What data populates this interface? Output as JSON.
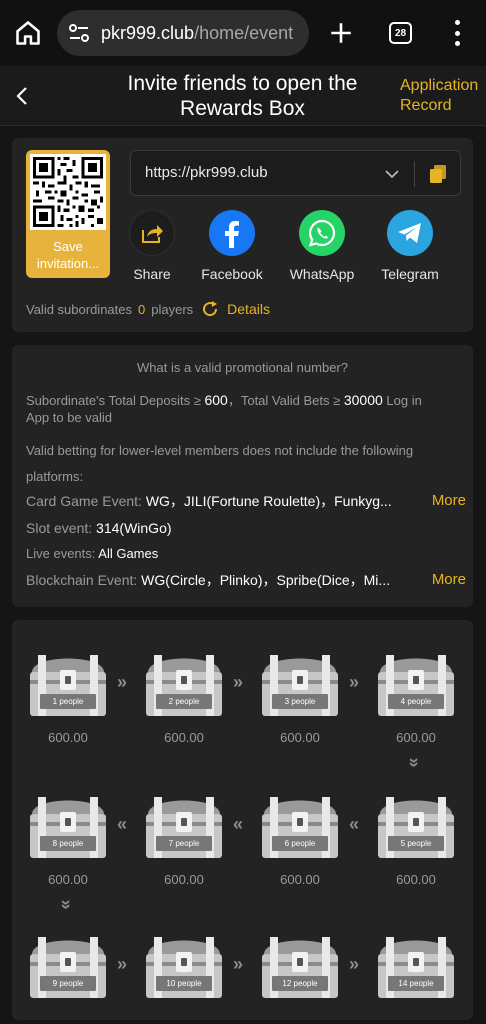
{
  "browser": {
    "url_host": "pkr999.club",
    "url_path": "/home/event",
    "tab_count": "28"
  },
  "header": {
    "title": "Invite friends to open the Rewards Box",
    "record_label": "Application Record"
  },
  "invite": {
    "save_label": "Save invitation...",
    "link": "https://pkr999.club",
    "share_label": "Share",
    "facebook_label": "Facebook",
    "whatsapp_label": "WhatsApp",
    "telegram_label": "Telegram",
    "valid_label": "Valid subordinates",
    "valid_count": "0",
    "players_label": "players",
    "details_label": "Details"
  },
  "rules": {
    "title": "What is a valid promotional number?",
    "line1_a": "Subordinate's Total Deposits ≥ ",
    "line1_b": "600",
    "line1_c": "，Total Valid Bets ≥ ",
    "line1_d": "30000",
    "line1_e": " Log in",
    "line2": "App to be valid",
    "line3": "Valid betting for lower-level members does not include the following",
    "line4": "platforms:",
    "card_label": "Card Game Event: ",
    "card_value": "WG，JILI(Fortune Roulette)，Funkyg...",
    "slot_label": "Slot event: ",
    "slot_value": "314(WinGo)",
    "live_label": "Live events: ",
    "live_value": "All Games",
    "block_label": "Blockchain Event: ",
    "block_value": "WG(Circle，Plinko)，Spribe(Dice，Mi...",
    "more_label": "More"
  },
  "chests": [
    {
      "label": "1 people",
      "value": "600.00"
    },
    {
      "label": "2 people",
      "value": "600.00"
    },
    {
      "label": "3 people",
      "value": "600.00"
    },
    {
      "label": "4 people",
      "value": "600.00"
    },
    {
      "label": "5 people",
      "value": "600.00"
    },
    {
      "label": "6 people",
      "value": "600.00"
    },
    {
      "label": "7 people",
      "value": "600.00"
    },
    {
      "label": "8 people",
      "value": "600.00"
    },
    {
      "label": "9 people",
      "value": ""
    },
    {
      "label": "10 people",
      "value": ""
    },
    {
      "label": "12 people",
      "value": ""
    },
    {
      "label": "14 people",
      "value": ""
    }
  ],
  "colors": {
    "accent": "#e6b422",
    "facebook": "#1877f2",
    "whatsapp": "#25d366",
    "telegram": "#2aa5e0"
  }
}
